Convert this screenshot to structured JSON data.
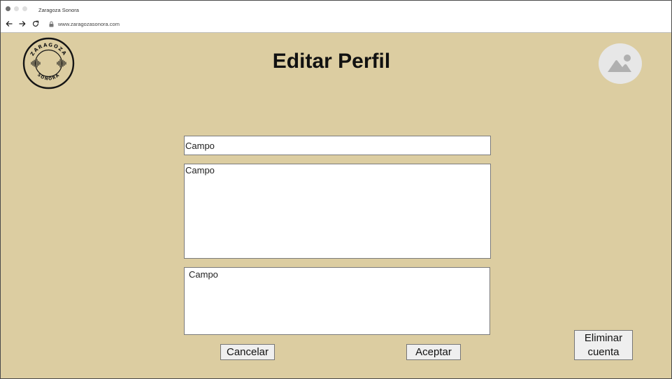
{
  "browser": {
    "tab_title": "Zaragoza Sonora",
    "url": "www.zaragozasonora.com",
    "dots": [
      "#6f6f6f",
      "#dedede",
      "#dedede"
    ]
  },
  "header": {
    "logo": {
      "top_text": "ZARAGOZA",
      "bottom_text": "SONORA"
    },
    "title": "Editar Perfil",
    "avatar_icon": "image-placeholder-icon"
  },
  "form": {
    "field1": {
      "placeholder": "Campo",
      "value": ""
    },
    "field2": {
      "placeholder": "Campo",
      "value": ""
    },
    "field3": {
      "placeholder": "Campo",
      "value": ""
    }
  },
  "actions": {
    "cancel_label": "Cancelar",
    "accept_label": "Aceptar",
    "delete_line1": "Eliminar",
    "delete_line2": "cuenta"
  },
  "colors": {
    "background": "#dccda1",
    "field_bg": "#ffffff",
    "button_bg": "#efefef",
    "avatar_bg": "#e7e7e7",
    "avatar_icon": "#b0b0b0"
  }
}
